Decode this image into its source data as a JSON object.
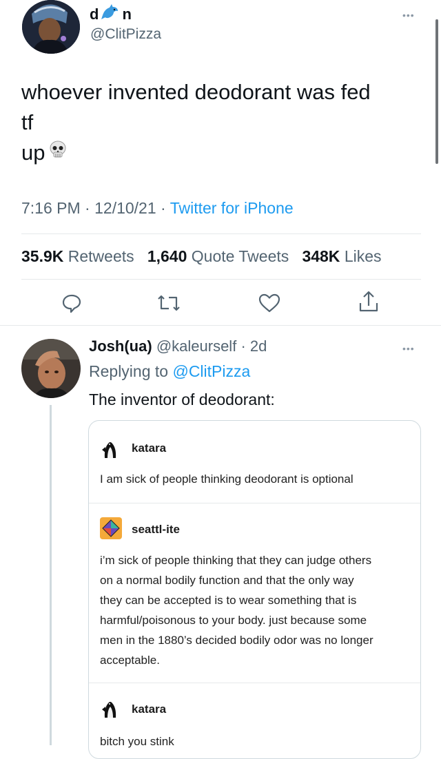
{
  "tweet": {
    "display_name_prefix": "d",
    "display_name_suffix": "n",
    "display_name_emoji": "dolphin",
    "handle": "@ClitPizza",
    "more_label": "•••",
    "text_lines": [
      "whoever invented deodorant was fed",
      "tf",
      "up"
    ],
    "text_emoji": "skull",
    "time": "7:16 PM",
    "sep1": "·",
    "date": "12/10/21",
    "sep2": "·",
    "source": "Twitter for iPhone",
    "retweets_count": "35.9K",
    "retweets_label": "Retweets",
    "quotes_count": "1,640",
    "quotes_label": "Quote Tweets",
    "likes_count": "348K",
    "likes_label": "Likes"
  },
  "actions": {
    "reply_icon": "reply-icon",
    "retweet_icon": "retweet-icon",
    "like_icon": "heart-icon",
    "share_icon": "share-icon"
  },
  "reply": {
    "name": "Josh(ua)",
    "handle": "@kaleurself",
    "sep": "·",
    "age": "2d",
    "replying_prefix": "Replying to",
    "replying_handle": "@ClitPizza",
    "text": "The inventor of deodorant:",
    "more_label": "•••"
  },
  "embed": {
    "posts": [
      {
        "name": "katara",
        "lines": [
          "I am sick of people thinking deodorant is optional"
        ]
      },
      {
        "name": "seattl-ite",
        "lines": [
          "i’m sick of people thinking that they can judge others",
          "on a normal bodily function and that the only way",
          "they can be accepted is to wear something that is",
          "harmful/poisonous to your body. just because some",
          "men in the 1880’s decided bodily odor was no longer",
          "acceptable."
        ]
      },
      {
        "name": "katara",
        "lines": [
          "bitch you stink"
        ]
      }
    ]
  },
  "colors": {
    "link": "#1d9bf0",
    "muted": "#536471",
    "divider": "#e6e9ea"
  }
}
